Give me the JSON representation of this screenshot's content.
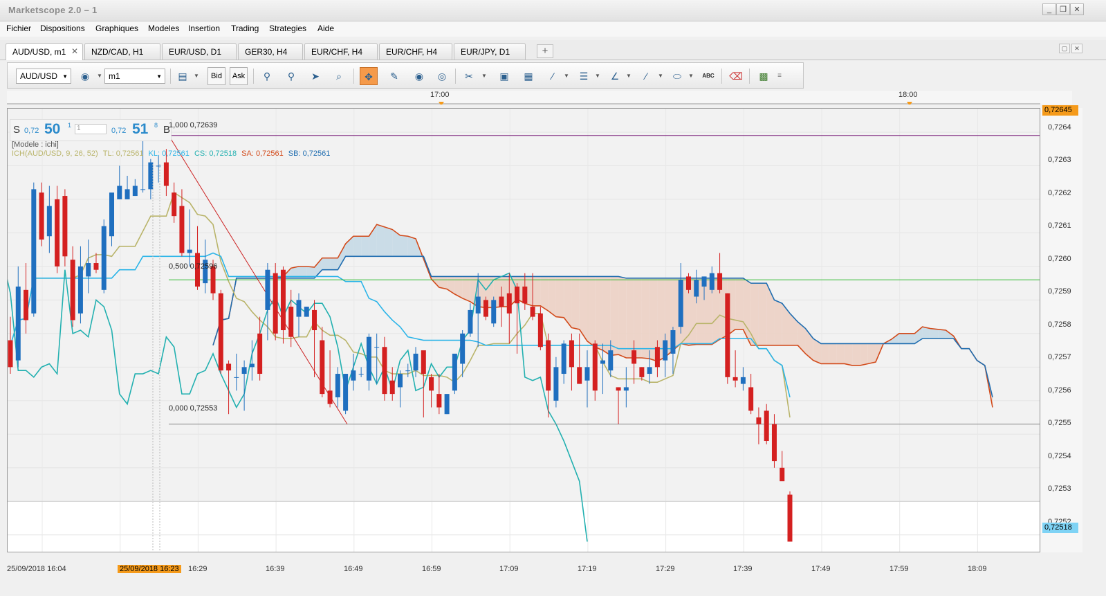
{
  "window": {
    "title": "Marketscope 2.0 – 1",
    "minimize": "_",
    "restore": "❒",
    "close": "✕"
  },
  "menu": [
    "Fichier",
    "Dispositions",
    "Graphiques",
    "Modeles",
    "Insertion",
    "Trading",
    "Strategies",
    "Aide"
  ],
  "tabs": [
    {
      "label": "AUD/USD, m1",
      "active": true
    },
    {
      "label": "NZD/CAD, H1"
    },
    {
      "label": "EUR/USD, D1"
    },
    {
      "label": "GER30, H4"
    },
    {
      "label": "EUR/CHF, H4"
    },
    {
      "label": "EUR/CHF, H4"
    },
    {
      "label": "EUR/JPY, D1"
    }
  ],
  "tab_add": "+",
  "tab_close": "✕",
  "toolbar": {
    "symbol": "AUD/USD",
    "timeframe": "m1",
    "bid_label": "Bid",
    "ask_label": "Ask",
    "abc_label": "ABC"
  },
  "quote": {
    "sell_letter": "S",
    "sell_prefix": "0,72",
    "sell_big": "50",
    "sell_sup": "1",
    "amount": "1",
    "buy_prefix": "0,72",
    "buy_big": "51",
    "buy_sup": "8",
    "buy_letter": "B"
  },
  "template_label": "[Modele : ichi]",
  "indicator": {
    "name": "ICH(AUD/USD, 9, 26, 52)",
    "tl": "TL: 0,72561",
    "kl": "KL: 0,72561",
    "cs": "CS: 0,72518",
    "sa": "SA: 0,72561",
    "sb": "SB: 0,72561"
  },
  "fib_labels": {
    "level_1": "1,000 0,72639",
    "level_05": "0,500 0,72596",
    "level_0": "0,000 0,72553"
  },
  "colors": {
    "accent": "#f59a4a",
    "bull": "#1f6fbf",
    "bear": "#d42020",
    "tenkan": "#b9b46a",
    "kijun": "#2ab4e8",
    "chikou": "#22b0b0",
    "spanA": "#d24a1a",
    "spanB": "#1f6db0",
    "cloud_bull": "#c5d9e6",
    "cloud_bear": "#ecd0c4",
    "fib_line": "#cc2222"
  },
  "top_axis": [
    "17:00",
    "18:00"
  ],
  "y_axis": [
    "0,7264",
    "0,7263",
    "0,7262",
    "0,7261",
    "0,7260",
    "0,7259",
    "0,7258",
    "0,7257",
    "0,7256",
    "0,7255",
    "0,7254",
    "0,7253",
    "0,7252"
  ],
  "y_tags": {
    "top": "0,72645",
    "last": "0,72518"
  },
  "x_axis": [
    "25/09/2018 16:04",
    "16:29",
    "16:39",
    "16:49",
    "16:59",
    "17:09",
    "17:19",
    "17:29",
    "17:39",
    "17:49",
    "17:59",
    "18:09"
  ],
  "cursor_time": "25/09/2018 16:23",
  "chart_data": {
    "type": "candlestick",
    "symbol": "AUD/USD",
    "timeframe": "m1",
    "ylim": [
      0.72515,
      0.72647
    ],
    "ohlc": [
      [
        0.72578,
        0.72585,
        0.72568,
        0.7257
      ],
      [
        0.72572,
        0.726,
        0.7257,
        0.72594
      ],
      [
        0.72593,
        0.72601,
        0.7258,
        0.72584
      ],
      [
        0.72586,
        0.72625,
        0.72585,
        0.72623
      ],
      [
        0.72622,
        0.72625,
        0.72606,
        0.72608
      ],
      [
        0.72609,
        0.72624,
        0.72604,
        0.72618
      ],
      [
        0.7262,
        0.72624,
        0.72598,
        0.726
      ],
      [
        0.72621,
        0.72623,
        0.726,
        0.72603
      ],
      [
        0.72602,
        0.72606,
        0.72582,
        0.72584
      ],
      [
        0.72586,
        0.72606,
        0.72583,
        0.726
      ],
      [
        0.72597,
        0.72608,
        0.72592,
        0.72601
      ],
      [
        0.72601,
        0.72604,
        0.72598,
        0.72599
      ],
      [
        0.72593,
        0.72614,
        0.72592,
        0.72612
      ],
      [
        0.72609,
        0.7262,
        0.72606,
        0.72622
      ],
      [
        0.7262,
        0.7263,
        0.7262,
        0.72624
      ],
      [
        0.7262,
        0.72627,
        0.7262,
        0.72623
      ],
      [
        0.72621,
        0.72626,
        0.72621,
        0.72624
      ],
      [
        0.72623,
        0.72638,
        0.72622,
        0.72623
      ],
      [
        0.72623,
        0.72632,
        0.7262,
        0.72631
      ],
      [
        0.7263,
        0.72633,
        0.72625,
        0.7263
      ],
      [
        0.72631,
        0.72635,
        0.72621,
        0.72624
      ],
      [
        0.72622,
        0.72625,
        0.72613,
        0.72615
      ],
      [
        0.72618,
        0.72623,
        0.72603,
        0.72604
      ],
      [
        0.72604,
        0.72617,
        0.726,
        0.72605
      ],
      [
        0.72604,
        0.72612,
        0.72593,
        0.72594
      ],
      [
        0.72595,
        0.72608,
        0.72592,
        0.72602
      ],
      [
        0.726,
        0.72602,
        0.7259,
        0.72592
      ],
      [
        0.72592,
        0.72593,
        0.72568,
        0.72569
      ],
      [
        0.72571,
        0.72572,
        0.72556,
        0.72569
      ],
      [
        0.72567,
        0.72574,
        0.72563,
        0.72567
      ],
      [
        0.72568,
        0.72572,
        0.72557,
        0.7257
      ],
      [
        0.7257,
        0.72578,
        0.72566,
        0.72571
      ],
      [
        0.7258,
        0.72585,
        0.72566,
        0.72568
      ],
      [
        0.72587,
        0.72601,
        0.72578,
        0.72599
      ],
      [
        0.72598,
        0.72601,
        0.72578,
        0.7258
      ],
      [
        0.72599,
        0.726,
        0.72577,
        0.72581
      ],
      [
        0.72588,
        0.72593,
        0.72576,
        0.72579
      ],
      [
        0.72585,
        0.72592,
        0.72579,
        0.7259
      ],
      [
        0.72585,
        0.72588,
        0.72585,
        0.72588
      ],
      [
        0.72587,
        0.7259,
        0.72567,
        0.72581
      ],
      [
        0.72578,
        0.72582,
        0.72561,
        0.72562
      ],
      [
        0.72563,
        0.72575,
        0.72558,
        0.72559
      ],
      [
        0.72561,
        0.7257,
        0.72558,
        0.72568
      ],
      [
        0.72557,
        0.72568,
        0.72556,
        0.72568
      ],
      [
        0.72566,
        0.72574,
        0.72563,
        0.72569
      ],
      [
        0.72568,
        0.7257,
        0.72567,
        0.72568
      ],
      [
        0.72566,
        0.7258,
        0.72563,
        0.72579
      ],
      [
        0.72576,
        0.7258,
        0.72565,
        0.72576
      ],
      [
        0.72576,
        0.72579,
        0.7256,
        0.72562
      ],
      [
        0.72566,
        0.7257,
        0.7256,
        0.72562
      ],
      [
        0.72564,
        0.72569,
        0.72558,
        0.72568
      ],
      [
        0.72569,
        0.72571,
        0.72567,
        0.72569
      ],
      [
        0.72569,
        0.72576,
        0.72567,
        0.72574
      ],
      [
        0.72575,
        0.72574,
        0.72555,
        0.72568
      ],
      [
        0.72567,
        0.72568,
        0.72558,
        0.72563
      ],
      [
        0.72562,
        0.72568,
        0.72556,
        0.72558
      ],
      [
        0.72556,
        0.72562,
        0.72556,
        0.72562
      ],
      [
        0.72563,
        0.72572,
        0.72562,
        0.72574
      ],
      [
        0.72571,
        0.72581,
        0.72567,
        0.7258
      ],
      [
        0.7258,
        0.72589,
        0.72579,
        0.72587
      ],
      [
        0.72586,
        0.72598,
        0.72576,
        0.72591
      ],
      [
        0.7259,
        0.72591,
        0.72584,
        0.72585
      ],
      [
        0.72583,
        0.72591,
        0.72582,
        0.7259
      ],
      [
        0.72591,
        0.72594,
        0.72582,
        0.72588
      ],
      [
        0.72592,
        0.72598,
        0.72577,
        0.72586
      ],
      [
        0.72594,
        0.72595,
        0.72574,
        0.72589
      ],
      [
        0.72594,
        0.72598,
        0.72587,
        0.72589
      ],
      [
        0.72588,
        0.72598,
        0.72584,
        0.72585
      ],
      [
        0.72586,
        0.72588,
        0.72575,
        0.72576
      ],
      [
        0.72578,
        0.7258,
        0.72555,
        0.72563
      ],
      [
        0.7256,
        0.72573,
        0.72558,
        0.7257
      ],
      [
        0.72568,
        0.72578,
        0.72565,
        0.72577
      ],
      [
        0.72578,
        0.7258,
        0.72563,
        0.7257
      ],
      [
        0.7257,
        0.7258,
        0.72565,
        0.72565
      ],
      [
        0.72566,
        0.72575,
        0.72558,
        0.7257
      ],
      [
        0.72577,
        0.72578,
        0.7256,
        0.72563
      ],
      [
        0.72571,
        0.72577,
        0.72562,
        0.72572
      ],
      [
        0.72569,
        0.72578,
        0.72567,
        0.72575
      ],
      [
        0.72564,
        0.72564,
        0.72553,
        0.72563
      ],
      [
        0.72563,
        0.7257,
        0.72558,
        0.72564
      ],
      [
        0.72575,
        0.72578,
        0.72565,
        0.72571
      ],
      [
        0.7257,
        0.7257,
        0.72566,
        0.72567
      ],
      [
        0.72568,
        0.72575,
        0.72565,
        0.7257
      ],
      [
        0.72576,
        0.72578,
        0.72567,
        0.7257
      ],
      [
        0.72572,
        0.7258,
        0.72567,
        0.72578
      ],
      [
        0.72574,
        0.72582,
        0.72568,
        0.72581
      ],
      [
        0.72582,
        0.72601,
        0.7258,
        0.72596
      ],
      [
        0.72597,
        0.72598,
        0.72592,
        0.72593
      ],
      [
        0.72591,
        0.72599,
        0.72589,
        0.72596
      ],
      [
        0.72594,
        0.72597,
        0.7259,
        0.72597
      ],
      [
        0.72593,
        0.726,
        0.72592,
        0.72598
      ],
      [
        0.72598,
        0.72604,
        0.72592,
        0.72593
      ],
      [
        0.72592,
        0.72592,
        0.72565,
        0.72567
      ],
      [
        0.72567,
        0.72575,
        0.72564,
        0.72566
      ],
      [
        0.72565,
        0.7257,
        0.72563,
        0.72567
      ],
      [
        0.72564,
        0.72568,
        0.72556,
        0.72557
      ],
      [
        0.72555,
        0.72558,
        0.72547,
        0.72553
      ],
      [
        0.72557,
        0.72559,
        0.72547,
        0.72548
      ],
      [
        0.72553,
        0.72556,
        0.7254,
        0.72542
      ],
      [
        0.7254,
        0.72545,
        0.72537,
        0.72536
      ],
      [
        0.72532,
        0.72533,
        0.72518,
        0.72518
      ]
    ],
    "ichimoku": {
      "params": [
        9,
        26,
        52
      ],
      "tenkan": 0.72561,
      "kijun": 0.72561,
      "chikou": 0.72518,
      "span_a": 0.72561,
      "span_b": 0.72561
    },
    "fibonacci": [
      {
        "level": "1,000",
        "value": 0.72639
      },
      {
        "level": "0,500",
        "value": 0.72596
      },
      {
        "level": "0,000",
        "value": 0.72553
      }
    ],
    "last_price": 0.72518
  }
}
